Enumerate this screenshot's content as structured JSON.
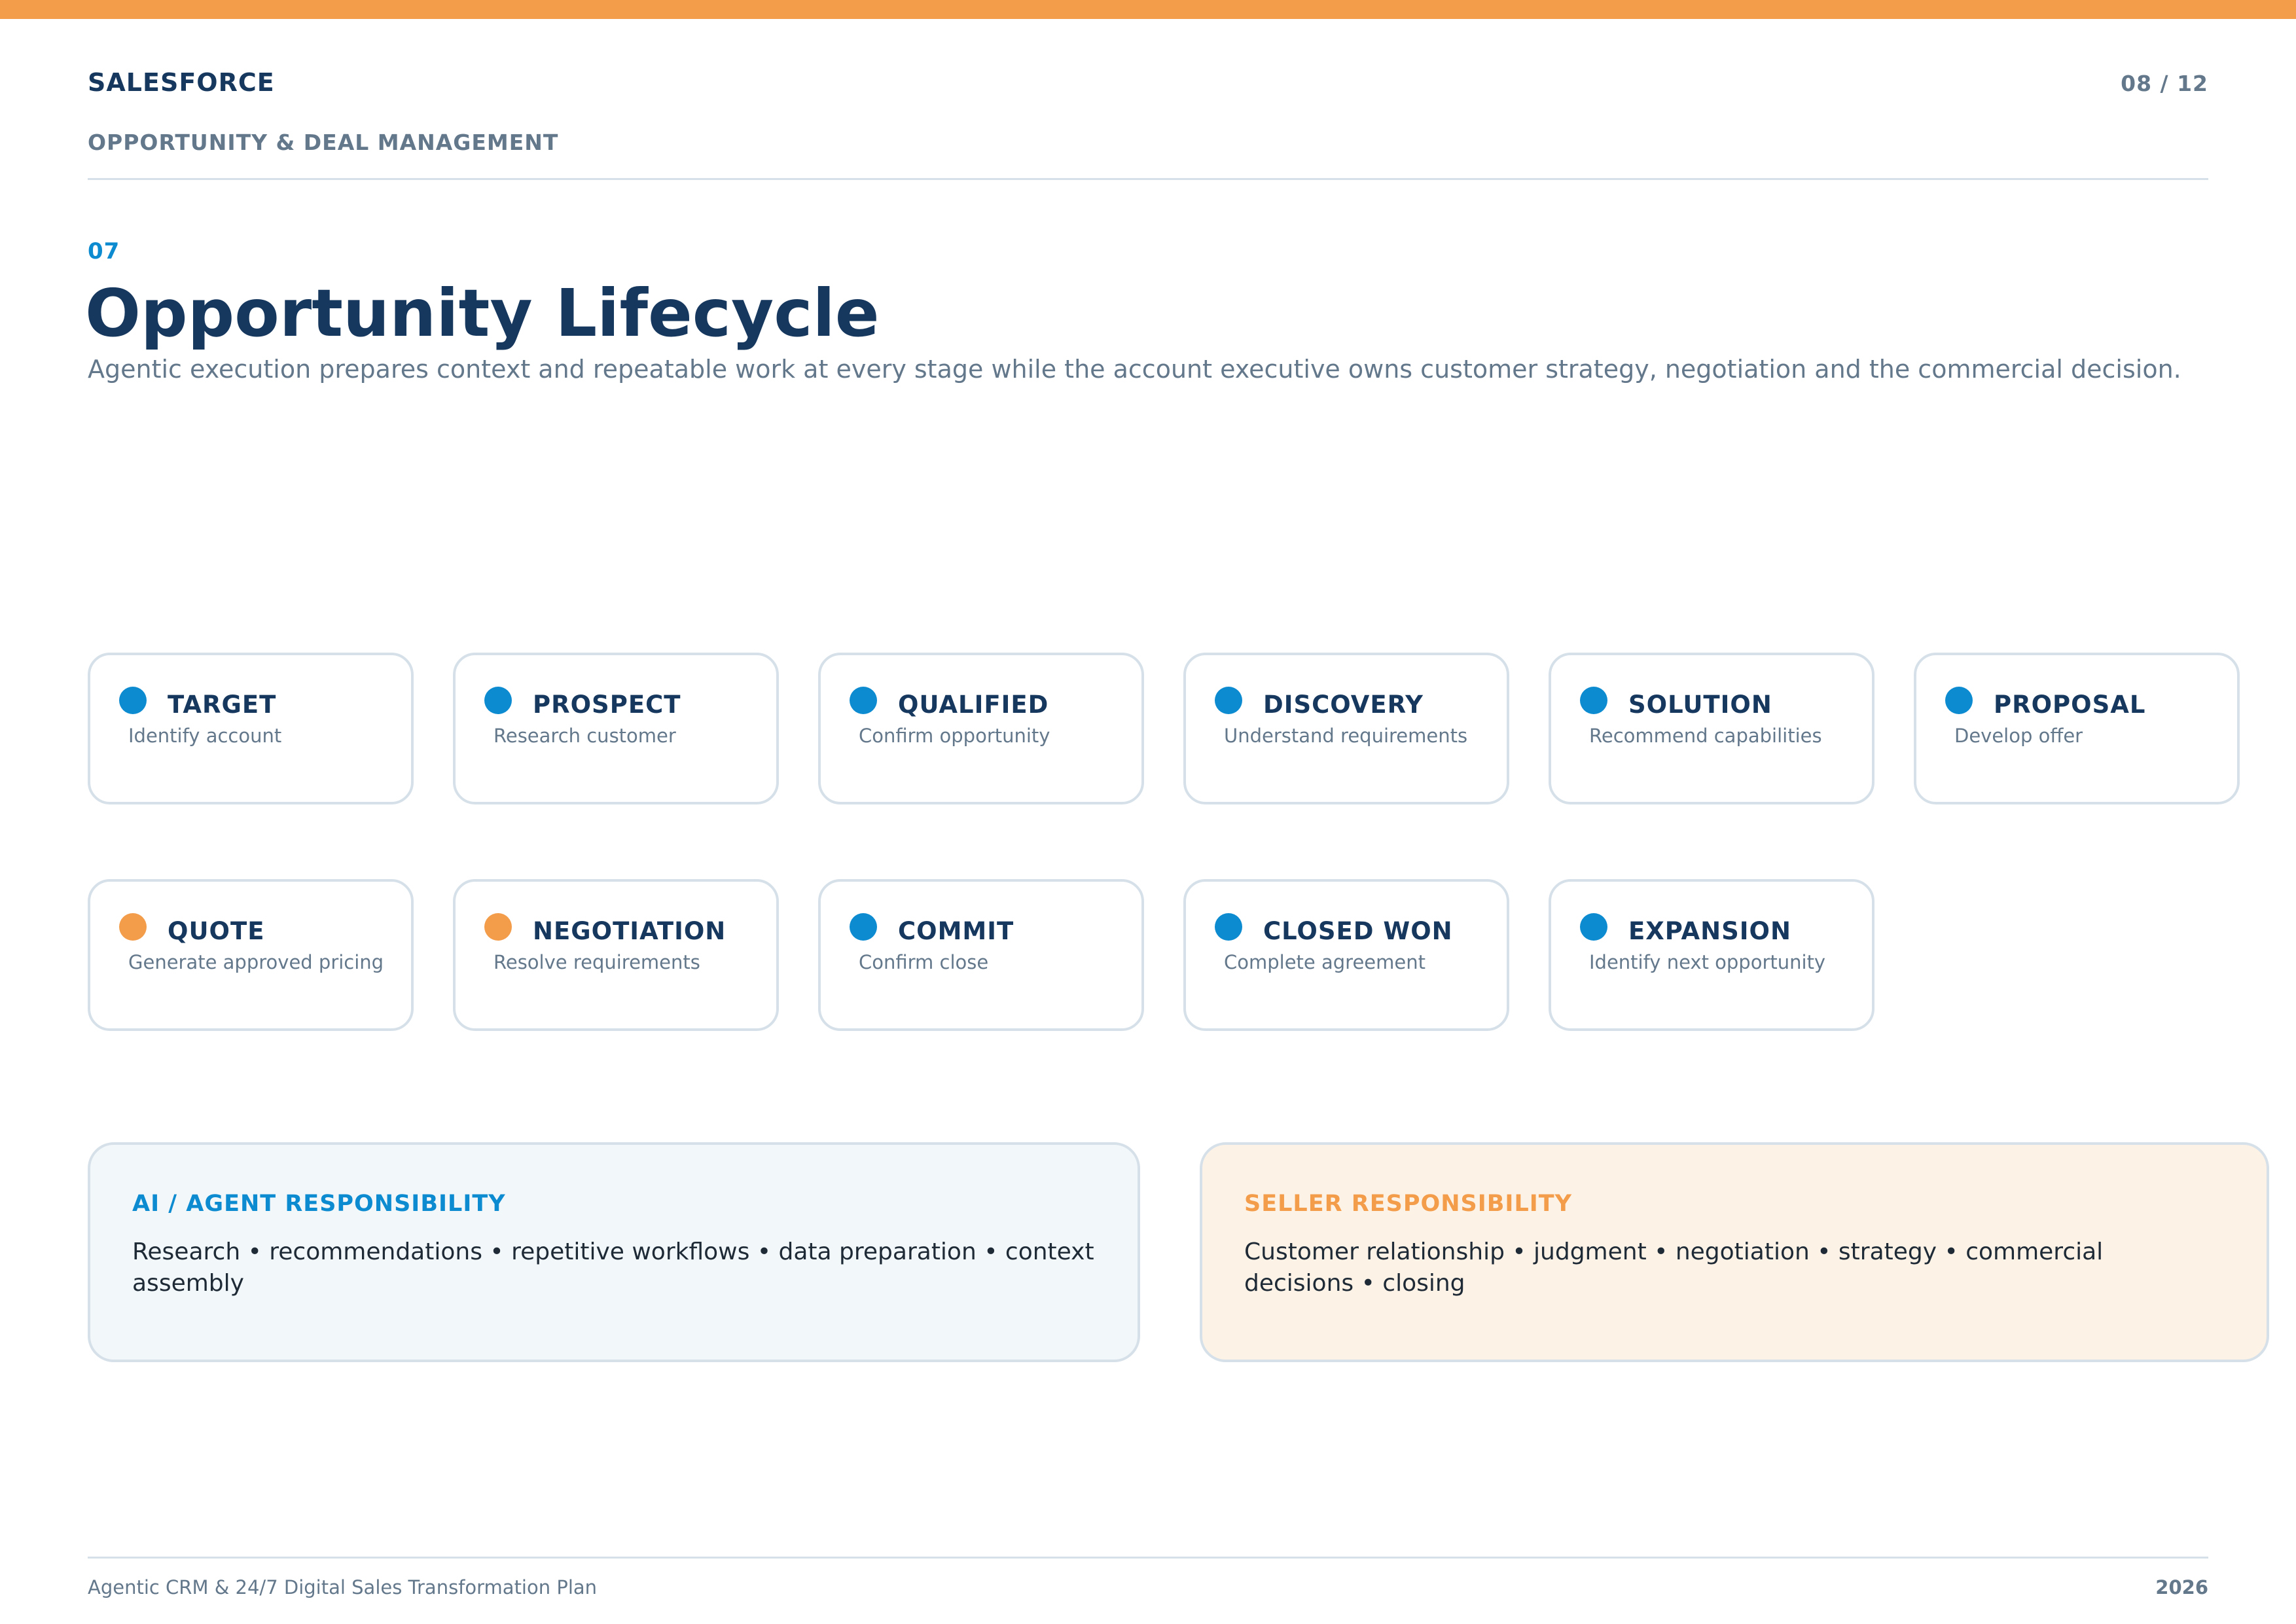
{
  "header": {
    "brand": "SALESFORCE",
    "section": "OPPORTUNITY & DEAL MANAGEMENT",
    "page": "08 / 12"
  },
  "slide": {
    "number": "07",
    "title": "Opportunity Lifecycle",
    "subtitle": "Agentic execution prepares context and repeatable work at every stage while the account executive owns customer strategy, negotiation and the commercial decision."
  },
  "stages": [
    {
      "name": "TARGET",
      "desc": "Identify account",
      "dot": "blue"
    },
    {
      "name": "PROSPECT",
      "desc": "Research customer",
      "dot": "blue"
    },
    {
      "name": "QUALIFIED",
      "desc": "Confirm opportunity",
      "dot": "blue"
    },
    {
      "name": "DISCOVERY",
      "desc": "Understand requirements",
      "dot": "blue"
    },
    {
      "name": "SOLUTION",
      "desc": "Recommend capabilities",
      "dot": "blue"
    },
    {
      "name": "PROPOSAL",
      "desc": "Develop offer",
      "dot": "blue"
    },
    {
      "name": "QUOTE",
      "desc": "Generate approved pricing",
      "dot": "orange"
    },
    {
      "name": "NEGOTIATION",
      "desc": "Resolve requirements",
      "dot": "orange"
    },
    {
      "name": "COMMIT",
      "desc": "Confirm close",
      "dot": "blue"
    },
    {
      "name": "CLOSED WON",
      "desc": "Complete agreement",
      "dot": "blue"
    },
    {
      "name": "EXPANSION",
      "desc": "Identify next opportunity",
      "dot": "blue"
    }
  ],
  "responsibilities": {
    "ai": {
      "title": "AI / AGENT RESPONSIBILITY",
      "text": "Research • recommendations • repetitive workflows • data preparation • context assembly"
    },
    "seller": {
      "title": "SELLER RESPONSIBILITY",
      "text": "Customer relationship • judgment • negotiation • strategy • commercial decisions • closing"
    }
  },
  "footer": {
    "left": "Agentic CRM & 24/7 Digital Sales Transformation Plan",
    "right": "2026"
  },
  "colors": {
    "accent_orange": "#f39c4a",
    "accent_blue": "#0d8bd1",
    "navy": "#17385e",
    "muted": "#64788c"
  }
}
